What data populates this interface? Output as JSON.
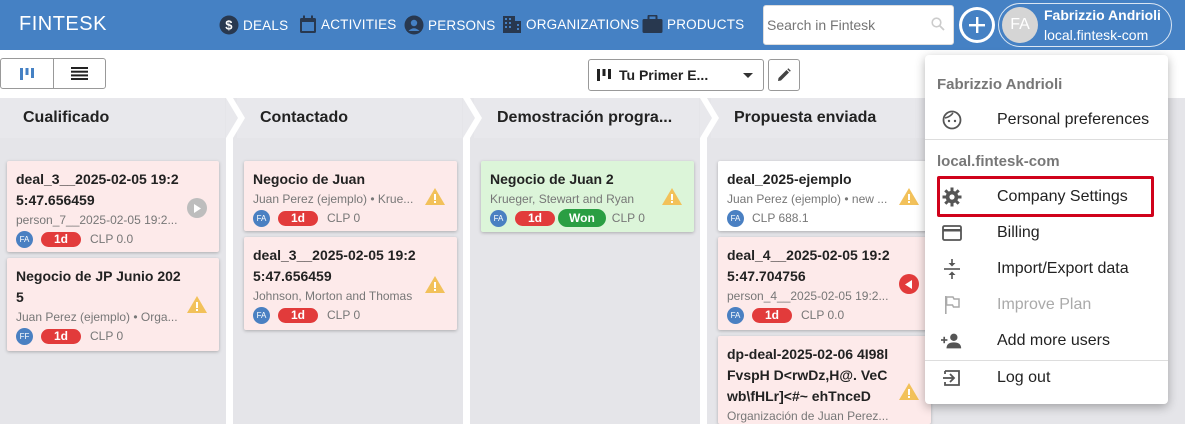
{
  "header": {
    "brand": "FINTESK",
    "nav": [
      {
        "label": "DEALS",
        "icon": "dollar-icon"
      },
      {
        "label": "ACTIVITIES",
        "icon": "calendar-icon"
      },
      {
        "label": "PERSONS",
        "icon": "person-icon"
      },
      {
        "label": "ORGANIZATIONS",
        "icon": "building-icon"
      },
      {
        "label": "PRODUCTS",
        "icon": "briefcase-icon"
      }
    ],
    "search_placeholder": "Search in Fintesk",
    "user": {
      "initials": "FA",
      "name": "Fabrizzio Andrioli",
      "domain": "local.fintesk-com"
    }
  },
  "toolbar": {
    "pipeline": "Tu Primer E..."
  },
  "columns": [
    {
      "title": "Cualificado"
    },
    {
      "title": "Contactado"
    },
    {
      "title": "Demostración progra..."
    },
    {
      "title": "Propuesta enviada"
    }
  ],
  "cards": {
    "c1a": {
      "title": "deal_3__2025-02-05 19:25:47.656459",
      "sub": "person_7__2025-02-05 19:2...",
      "avatar": "FA",
      "days": "1d",
      "amount": "CLP 0.0"
    },
    "c1b": {
      "title": "Negocio de JP Junio 2025",
      "sub": "Juan Perez (ejemplo) • Orga...",
      "avatar": "FF",
      "days": "1d",
      "amount": "CLP 0"
    },
    "c2a": {
      "title": "Negocio de Juan",
      "sub": "Juan Perez (ejemplo) • Krue...",
      "avatar": "FA",
      "days": "1d",
      "amount": "CLP 0"
    },
    "c2b": {
      "title": "deal_3__2025-02-05 19:25:47.656459",
      "sub": "Johnson, Morton and Thomas",
      "avatar": "FA",
      "days": "1d",
      "amount": "CLP 0"
    },
    "c3a": {
      "title": "Negocio de Juan 2",
      "sub": "Krueger, Stewart and Ryan",
      "avatar": "FA",
      "days": "1d",
      "won": "Won",
      "amount": "CLP 0"
    },
    "c4a": {
      "title": "deal_2025-ejemplo",
      "sub": "Juan Perez (ejemplo) • new ...",
      "avatar": "FA",
      "amount": "CLP 688.1"
    },
    "c4b": {
      "title": "deal_4__2025-02-05 19:25:47.704756",
      "sub": "person_4__2025-02-05 19:2...",
      "avatar": "FA",
      "days": "1d",
      "amount": "CLP 0.0"
    },
    "c4c": {
      "title": "dp-deal-2025-02-06 4I98lFvspH D<rwDz,H@. VeCwb\\fHLr]<#~ ehTnceD",
      "sub": "Organización de Juan Perez..."
    }
  },
  "menu": {
    "user_name": "Fabrizzio Andrioli",
    "personal_preferences": "Personal preferences",
    "domain": "local.fintesk-com",
    "company_settings": "Company Settings",
    "billing": "Billing",
    "import_export": "Import/Export data",
    "improve_plan": "Improve Plan",
    "add_users": "Add more users",
    "logout": "Log out"
  },
  "colors": {
    "brand_blue": "#4581c4",
    "danger": "#e23b3b",
    "success": "#2a9e43",
    "warning": "#f2c15a",
    "highlight": "#d0021b"
  }
}
